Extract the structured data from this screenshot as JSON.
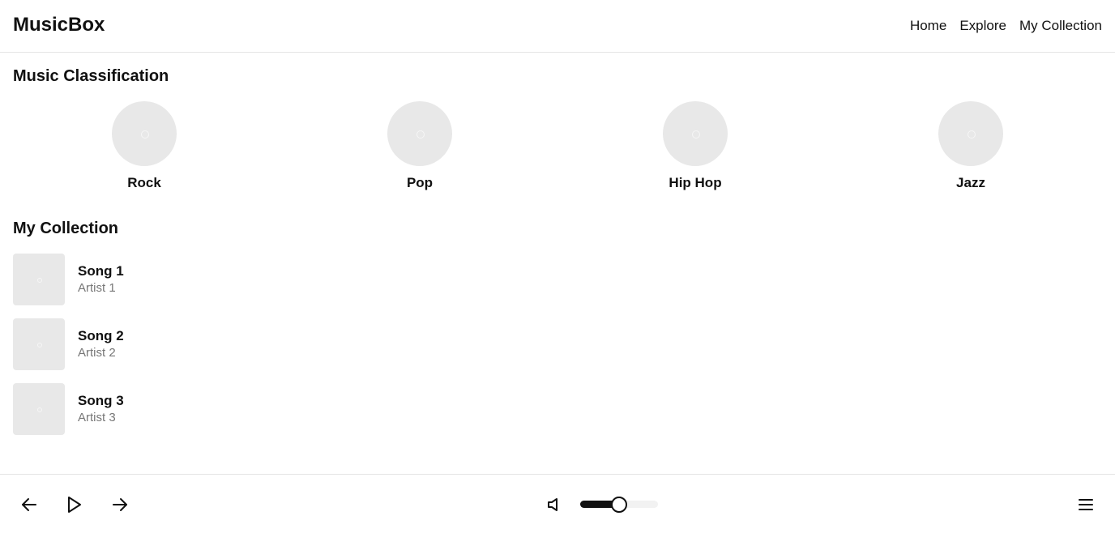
{
  "header": {
    "logo": "MusicBox",
    "nav": [
      "Home",
      "Explore",
      "My Collection"
    ]
  },
  "classification": {
    "title": "Music Classification",
    "categories": [
      "Rock",
      "Pop",
      "Hip Hop",
      "Jazz"
    ]
  },
  "collection": {
    "title": "My Collection",
    "songs": [
      {
        "title": "Song 1",
        "artist": "Artist 1"
      },
      {
        "title": "Song 2",
        "artist": "Artist 2"
      },
      {
        "title": "Song 3",
        "artist": "Artist 3"
      }
    ]
  },
  "player": {
    "icons": [
      "previous-icon",
      "play-icon",
      "next-icon",
      "volume-icon",
      "menu-icon"
    ],
    "volume_level": 0.5,
    "accent": "#111111"
  }
}
